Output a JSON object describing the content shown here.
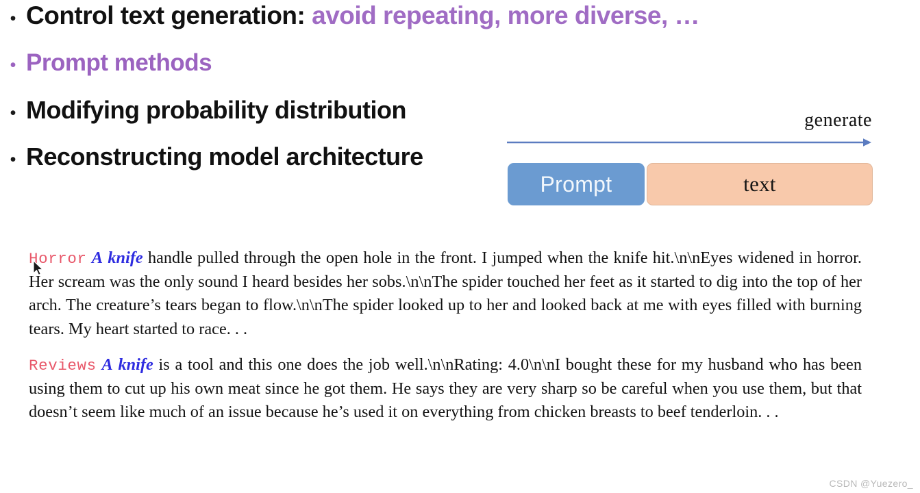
{
  "slide": {
    "bullets": [
      {
        "marker": "•",
        "lead": "Control text generation: ",
        "accent": "avoid repeating,  more diverse, …",
        "color": "#111111",
        "accent_color": "#a06cc4"
      },
      {
        "marker": "•",
        "lead": "Prompt methods",
        "accent": "",
        "color": "#9b63c0",
        "accent_color": "#9b63c0"
      },
      {
        "marker": "•",
        "lead": "Modifying probability distribution",
        "accent": "",
        "color": "#111111",
        "accent_color": "#a06cc4"
      },
      {
        "marker": "•",
        "lead": "Reconstructing model architecture",
        "accent": "",
        "color": "#111111",
        "accent_color": "#a06cc4"
      }
    ]
  },
  "diagram": {
    "arrow_label": "generate",
    "arrow_color": "#5b7cc0",
    "prompt_box": {
      "label": "Prompt",
      "fill": "#6b9bd1",
      "text_color": "#f2f7fc"
    },
    "text_box": {
      "label": "text",
      "fill": "#f8c9ab",
      "border": "#e0b699",
      "text_color": "#141414"
    }
  },
  "samples": {
    "tag_color": "#e8586a",
    "keyword_color": "#2e2ce0",
    "items": [
      {
        "tag": "Horror",
        "keyword_a": "A",
        "keyword_b": "knife",
        "body": " handle pulled through the open hole in the front.  I jumped when the knife hit.\\n\\nEyes widened in horror. Her scream was the only sound I heard besides her sobs.\\n\\nThe spider touched her feet as it started to dig into the top of her arch.  The creature’s tears began to flow.\\n\\nThe spider looked up to her and looked back at me with eyes filled with burning tears. My heart started to race. . ."
      },
      {
        "tag": "Reviews",
        "keyword_a": "A",
        "keyword_b": "knife",
        "body": " is a tool and this one does the job well.\\n\\nRating: 4.0\\n\\nI bought these for my husband who has been using them to cut up his own meat since he got them.  He says they are very sharp so be careful when you use them, but that doesn’t seem like much of an issue because he’s used it on everything from chicken breasts to beef tenderloin. . ."
      }
    ]
  },
  "watermark": {
    "text": "CSDN @Yuezero_"
  }
}
